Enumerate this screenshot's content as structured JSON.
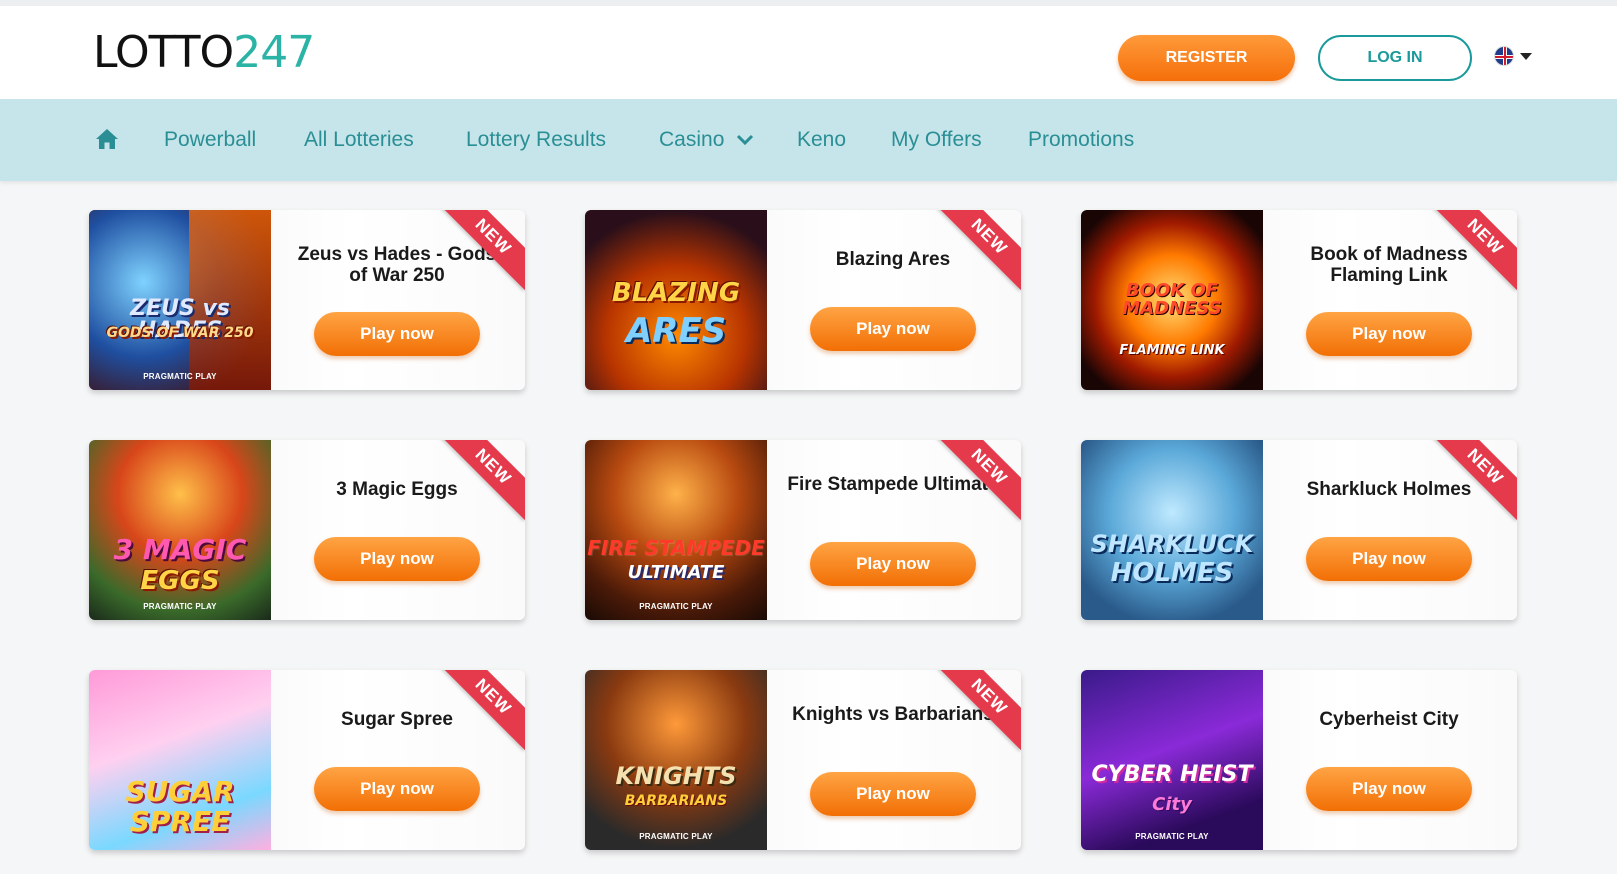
{
  "header": {
    "logo_main": "LOTTO",
    "logo_number": "247",
    "register_label": "REGISTER",
    "login_label": "LOG IN",
    "language_icon": "uk-flag-icon"
  },
  "nav": {
    "home_icon": "home-icon",
    "items": [
      "Powerball",
      "All Lotteries",
      "Lottery Results",
      "Casino",
      "Keno",
      "My Offers",
      "Promotions"
    ]
  },
  "games": [
    {
      "name": "Zeus vs Hades - Gods of War 250",
      "thumb_title": "ZEUS vs HADES",
      "thumb_sub": "GODS OF WAR 250",
      "provider": "PRAGMATIC PLAY",
      "badge": "NEW",
      "play_label": "Play now"
    },
    {
      "name": "Blazing Ares",
      "thumb_title": "BLAZING",
      "thumb_sub": "ARES",
      "provider": "",
      "badge": "NEW",
      "play_label": "Play now"
    },
    {
      "name": "Book of Madness Flaming Link",
      "thumb_title": "BOOK OF MADNESS",
      "thumb_sub": "FLAMING LINK",
      "provider": "",
      "badge": "NEW",
      "play_label": "Play now"
    },
    {
      "name": "3 Magic Eggs",
      "thumb_title": "3 MAGIC",
      "thumb_sub": "EGGS",
      "provider": "PRAGMATIC PLAY",
      "badge": "NEW",
      "play_label": "Play now"
    },
    {
      "name": "Fire Stampede Ultimate",
      "thumb_title": "FIRE STAMPEDE",
      "thumb_sub": "ULTIMATE",
      "provider": "PRAGMATIC PLAY",
      "badge": "NEW",
      "play_label": "Play now"
    },
    {
      "name": "Sharkluck Holmes",
      "thumb_title": "SHARKLUCK",
      "thumb_sub": "HOLMES",
      "provider": "",
      "badge": "NEW",
      "play_label": "Play now"
    },
    {
      "name": "Sugar Spree",
      "thumb_title": "SUGAR",
      "thumb_sub": "SPREE",
      "provider": "",
      "badge": "NEW",
      "play_label": "Play now"
    },
    {
      "name": "Knights vs Barbarians",
      "thumb_title": "KNIGHTS",
      "thumb_sub": "BARBARIANS",
      "provider": "PRAGMATIC PLAY",
      "badge": "NEW",
      "play_label": "Play now"
    },
    {
      "name": "Cyberheist City",
      "thumb_title": "CYBER HEIST",
      "thumb_sub": "City",
      "provider": "PRAGMATIC PLAY",
      "badge": "",
      "play_label": "Play now"
    }
  ],
  "colors": {
    "accent_orange": "#f56f0a",
    "teal": "#2a8f95",
    "nav_bg": "#c6e5ea",
    "badge_red": "#e53a4c"
  }
}
